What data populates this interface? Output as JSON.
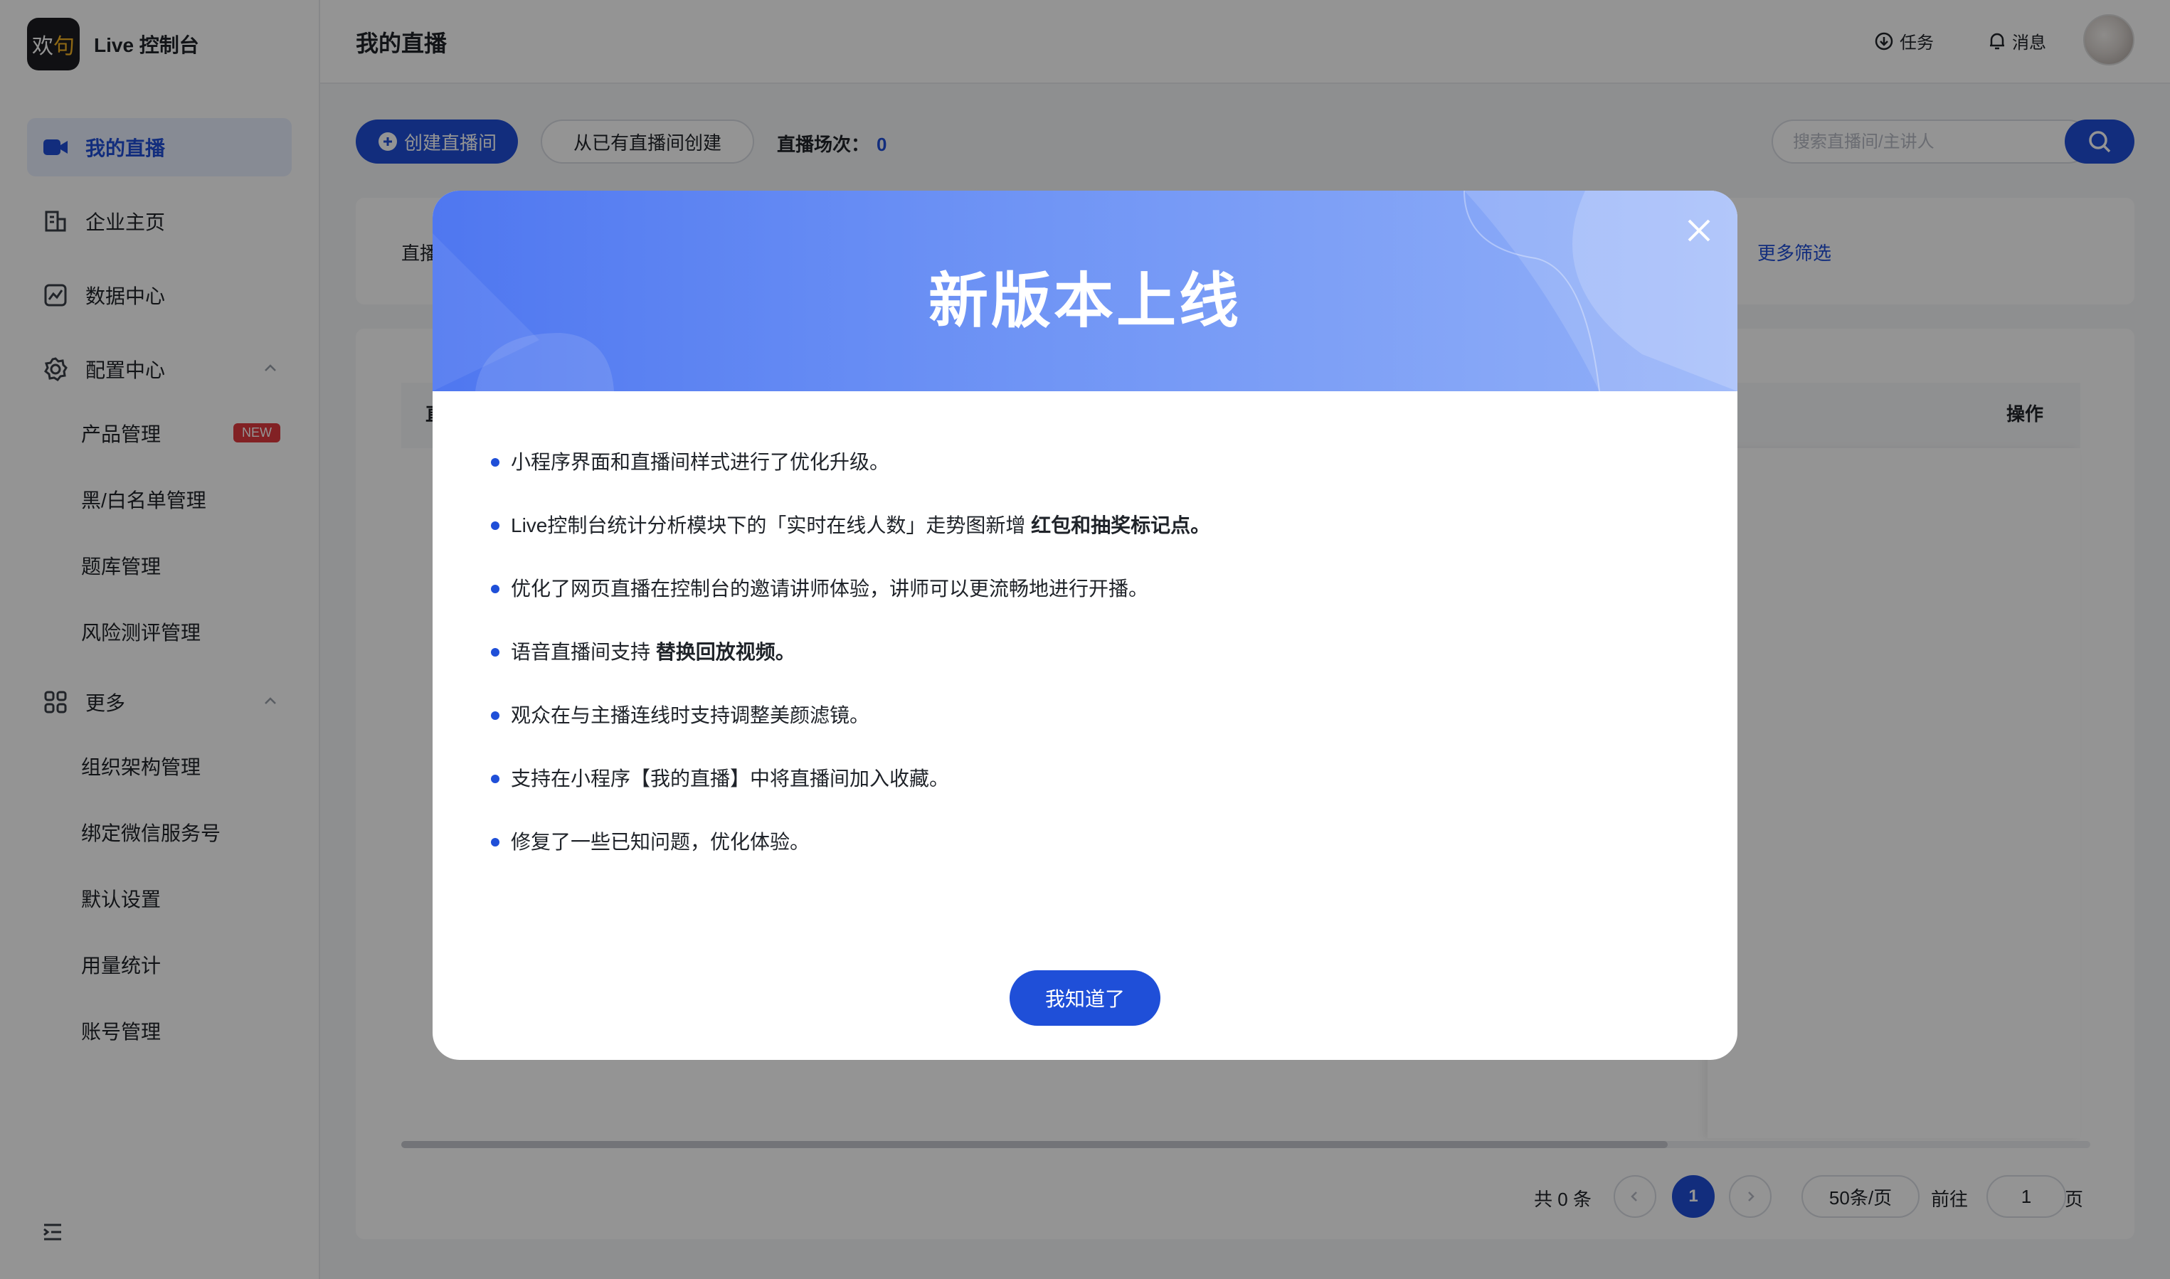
{
  "brand": {
    "logo_text_a": "欢",
    "logo_text_b": "句",
    "title": "Live 控制台"
  },
  "sidebar": {
    "items": [
      {
        "label": "我的直播",
        "icon": "video-camera-icon",
        "active": true
      },
      {
        "label": "企业主页",
        "icon": "enterprise-page-icon"
      },
      {
        "label": "数据中心",
        "icon": "data-chart-icon"
      },
      {
        "label": "配置中心",
        "icon": "gear-icon",
        "expanded": true
      }
    ],
    "config_children": [
      {
        "label": "产品管理",
        "badge": "NEW"
      },
      {
        "label": "黑/白名单管理"
      },
      {
        "label": "题库管理"
      },
      {
        "label": "风险测评管理"
      }
    ],
    "more": {
      "label": "更多",
      "icon": "grid-icon",
      "expanded": true
    },
    "more_children": [
      {
        "label": "组织架构管理"
      },
      {
        "label": "绑定微信服务号"
      },
      {
        "label": "默认设置"
      },
      {
        "label": "用量统计"
      },
      {
        "label": "账号管理"
      }
    ]
  },
  "header": {
    "title": "我的直播",
    "tasks_label": "任务",
    "messages_label": "消息"
  },
  "toolbar": {
    "create_label": "创建直播间",
    "create_from_existing_label": "从已有直播间创建",
    "sessions_label": "直播场次：",
    "sessions_count": "0",
    "search_placeholder": "搜索直播间/主讲人"
  },
  "filters": {
    "first_label_partial": "直播",
    "more_filters_label": "更多筛选"
  },
  "table": {
    "first_header_partial": "直",
    "op_header": "操作"
  },
  "pagination": {
    "total_label": "共 0 条",
    "current_page": "1",
    "page_size_label": "50条/页",
    "goto_label": "前往",
    "goto_value": "1",
    "page_unit": "页"
  },
  "modal": {
    "title": "新版本上线",
    "items": [
      {
        "text": "小程序界面和直播间样式进行了优化升级。",
        "bold": ""
      },
      {
        "text": "Live控制台统计分析模块下的「实时在线人数」走势图新增 ",
        "bold": "红包和抽奖标记点。"
      },
      {
        "text": "优化了网页直播在控制台的邀请讲师体验，讲师可以更流畅地进行开播。",
        "bold": ""
      },
      {
        "text": "语音直播间支持 ",
        "bold": "替换回放视频。"
      },
      {
        "text": "观众在与主播连线时支持调整美颜滤镜。",
        "bold": ""
      },
      {
        "text": "支持在小程序【我的直播】中将直播间加入收藏。",
        "bold": ""
      },
      {
        "text": "修复了一些已知问题，优化体验。",
        "bold": ""
      }
    ],
    "ok_label": "我知道了"
  },
  "colors": {
    "primary": "#1f4fd8",
    "badge_red": "#e0393e",
    "banner_start": "#4f77f0",
    "banner_end": "#92b0f8"
  }
}
